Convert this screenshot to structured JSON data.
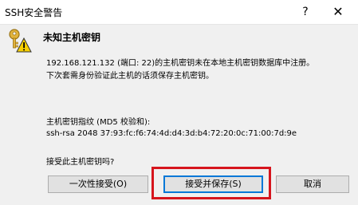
{
  "window": {
    "title": "SSH安全警告",
    "help_glyph": "?",
    "close_glyph": "✕"
  },
  "dialog": {
    "heading": "未知主机密钥",
    "message_line1": "192.168.121.132 (端口: 22)的主机密钥未在本地主机密钥数据库中注册。",
    "message_line2": "下次套需身份验证此主机的话须保存主机密钥。",
    "fingerprint_label": "主机密钥指纹 (MD5 校验和):",
    "fingerprint_value": "ssh-rsa 2048 37:93:fc:f6:74:4d:d4:3d:b4:72:20:0c:71:00:7d:9e",
    "question": "接受此主机密钥吗?",
    "icon": "key-warning-icon"
  },
  "buttons": {
    "accept_once": "一次性接受(O)",
    "accept_and_save": "接受并保存(S)",
    "cancel": "取消"
  },
  "annotation": {
    "highlight_color": "#d6151d"
  }
}
